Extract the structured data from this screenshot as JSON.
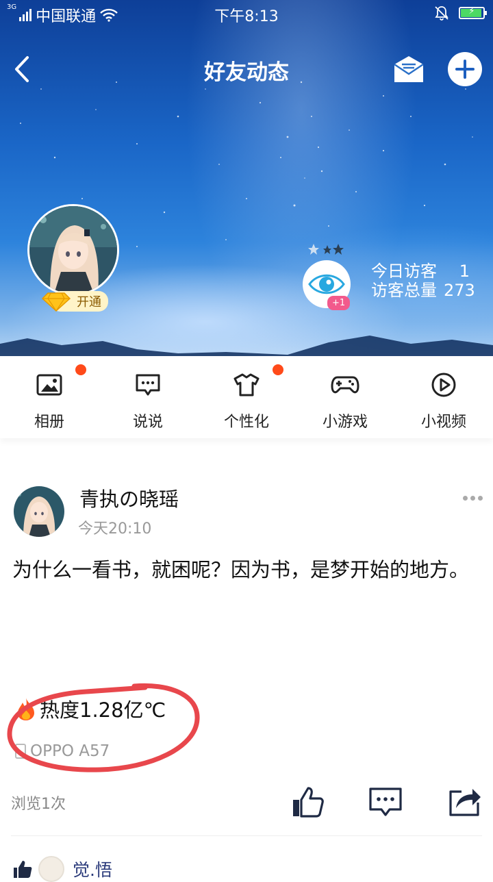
{
  "status_bar": {
    "network": "3G",
    "carrier": "中国联通",
    "time": "下午8:13",
    "battery_charging": true,
    "battery_percent": 100
  },
  "header": {
    "title": "好友动态",
    "accent": "#1a66c7"
  },
  "profile": {
    "vip_label": "开通",
    "visitors": {
      "today_label": "今日访客",
      "today_value": "1",
      "total_label": "访客总量",
      "total_value": "273"
    },
    "eye_badge": "+1"
  },
  "menu": [
    {
      "label": "相册",
      "icon": "photo-album-icon",
      "has_dot": true
    },
    {
      "label": "说说",
      "icon": "chat-bubble-icon",
      "has_dot": false
    },
    {
      "label": "个性化",
      "icon": "tshirt-icon",
      "has_dot": true
    },
    {
      "label": "小游戏",
      "icon": "gamepad-icon",
      "has_dot": false
    },
    {
      "label": "小视频",
      "icon": "play-video-icon",
      "has_dot": false
    }
  ],
  "post": {
    "author": "青执の晓瑶",
    "time": "今天20:10",
    "text": "为什么一看书，就困呢？因为书，是梦开始的地方。",
    "heat": "热度1.28亿℃",
    "device": "OPPO A57",
    "views": "浏览1次",
    "liker_name": "觉.悟"
  },
  "colors": {
    "dot_red": "#ff4a1a",
    "annotation_red": "#e8474c",
    "link_blue": "#2a3a7a"
  }
}
